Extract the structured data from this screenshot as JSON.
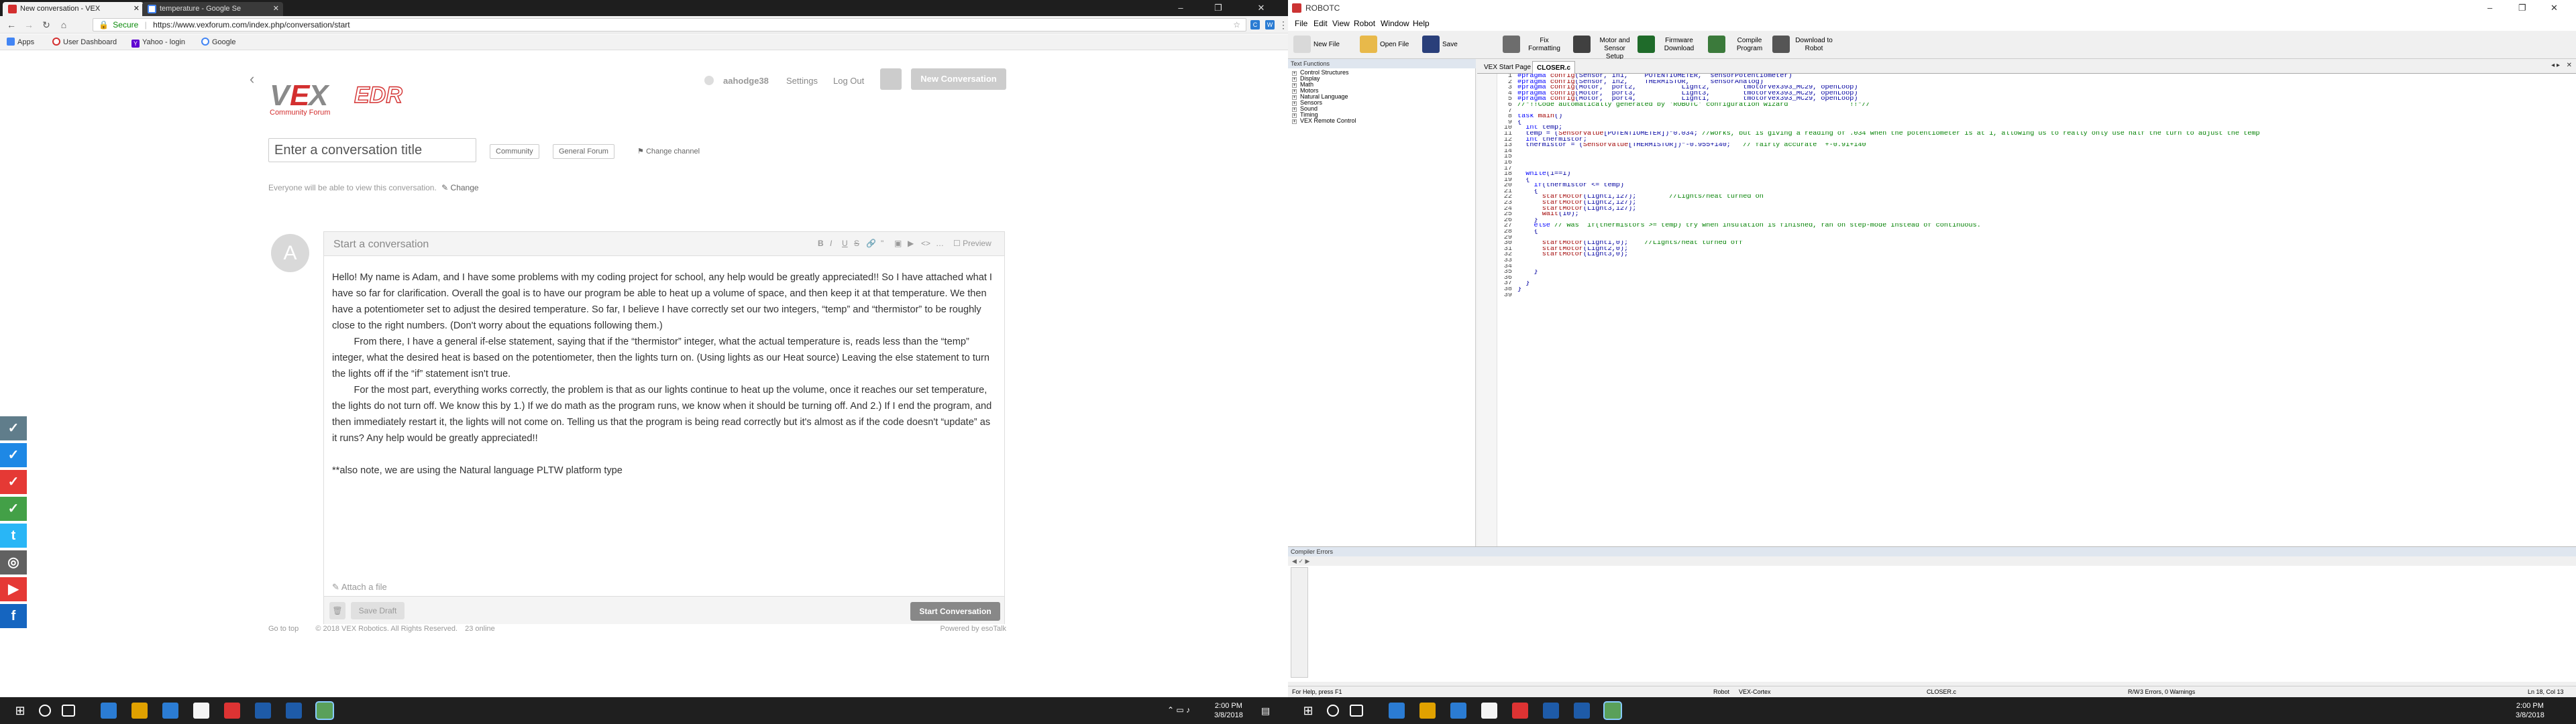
{
  "browser": {
    "tabs": [
      {
        "label": "New conversation - VEX",
        "active": true
      },
      {
        "label": "temperature - Google Se",
        "active": false
      }
    ],
    "window_controls": [
      "–",
      "❐",
      "✕"
    ],
    "secure_label": "Secure",
    "url": "https://www.vexforum.com/index.php/conversation/start",
    "bookmarks": [
      "Apps",
      "User Dashboard",
      "Yahoo - login",
      "Google"
    ]
  },
  "forum": {
    "logo_text": "VEX EDR",
    "logo_subtitle": "Community Forum",
    "header": {
      "username": "aahodge38",
      "settings": "Settings",
      "logout": "Log Out",
      "new_conversation": "New Conversation"
    },
    "title_placeholder": "Enter a conversation title",
    "channels": [
      "Community",
      "General Forum"
    ],
    "change_channel": "Change channel",
    "visibility_text": "Everyone will be able to view this conversation.",
    "visibility_change": "Change",
    "avatar_letter": "A",
    "editor_title": "Start a conversation",
    "format_tools": [
      "B",
      "I",
      "U",
      "S",
      "🔗",
      "\"",
      "▣",
      "▶",
      "<>",
      "…"
    ],
    "preview_label": "Preview",
    "body_paragraphs": [
      "Hello! My name is Adam, and I have some problems with my coding project for school, any help would be greatly appreciated!! So I have attached what I have so far for clarification. Overall the goal is to have our program be able to heat up a volume of space, and then keep it at that temperature. We then have a potentiometer set to adjust the desired temperature. So far, I believe I have correctly set our two integers, “temp” and “thermistor” to be roughly close to the right numbers. (Don't worry about the equations following them.)",
      "        From there, I have a general if-else statement, saying that if the “thermistor” integer, what the actual temperature is, reads less than the “temp” integer, what the desired heat is based on the potentiometer, then the lights turn on. (Using lights as our Heat source) Leaving the else statement to turn the lights off if the “if” statement isn't true.",
      "        For the most part, everything works correctly, the problem is that as our lights continue to heat up the volume, once it reaches our set temperature, the lights do not turn off. We know this by 1.) If we do math as the program runs, we know when it should be turning off. And 2.) If I end the program, and then immediately restart it, the lights will not come on. Telling us that the program is being read correctly but it's almost as if the code doesn't “update” as it runs? Any help would be greatly appreciated!!",
      "**also note, we are using the Natural language PLTW platform type"
    ],
    "attach_label": "Attach a file",
    "save_draft": "Save Draft",
    "start_conversation": "Start Conversation",
    "footer": {
      "goto_top": "Go to top",
      "copyright": "© 2018 VEX Robotics. All Rights Reserved.",
      "online": "23 online",
      "powered": "Powered by esoTalk"
    },
    "social_colors": [
      "#607d8b",
      "#1e88e5",
      "#e53935",
      "#43a047",
      "#29b6f6",
      "#616161",
      "#e53935",
      "#1565c0"
    ]
  },
  "robotc": {
    "title": "ROBOTC",
    "menus": [
      "File",
      "Edit",
      "View",
      "Robot",
      "Window",
      "Help"
    ],
    "toolbar": [
      {
        "label": "New File",
        "color": "#d9d9d9"
      },
      {
        "label": "Open File",
        "color": "#e8b94a"
      },
      {
        "label": "Save",
        "color": "#2a3f7a"
      },
      {
        "label": "Fix Formatting",
        "color": "#6d6d6d"
      },
      {
        "label": "Motor and Sensor Setup",
        "color": "#404040"
      },
      {
        "label": "Firmware Download",
        "color": "#1f6b2a"
      },
      {
        "label": "Compile Program",
        "color": "#3b7a3b"
      },
      {
        "label": "Download to Robot",
        "color": "#555555"
      }
    ],
    "functions_header": "Text Functions",
    "functions": [
      "Control Structures",
      "Display",
      "Math",
      "Motors",
      "Natural Language",
      "Sensors",
      "Sound",
      "Timing",
      "VEX Remote Control"
    ],
    "file_tabs": [
      "VEX Start Page",
      "CLOSER.c"
    ],
    "code_lines": [
      "#pragma config(Sensor, in1,    POTENTIOMETER,  sensorPotentiometer)",
      "#pragma config(Sensor, in2,    THERMISTOR,     sensorAnalog)",
      "#pragma config(Motor,  port2,           Light2,        tmotorVex393_MC29, openLoop)",
      "#pragma config(Motor,  port3,           Light3,        tmotorVex393_MC29, openLoop)",
      "#pragma config(Motor,  port4,           Light1,        tmotorVex393_MC29, openLoop)",
      "//*!!Code automatically generated by 'ROBOTC' configuration wizard               !!*//",
      "",
      "task main()",
      "{",
      "  int temp;",
      "  temp = (SensorValue[POTENTIOMETER])*0.034; //works, but is giving a reading of .034 when the potentiometer is at 1, allowing us to really only use half the turn to adjust the temp",
      "  int thermistor;",
      "  thermistor = (SensorValue[THERMISTOR])*-0.955+140;   // fairly accurate  +-0.91+140",
      "",
      "",
      "",
      "",
      "  while(1==1)",
      "  {",
      "    if(thermistor <= temp)",
      "    {",
      "      startMotor(Light1,127);        //Lights/heat turned on",
      "      startMotor(Light2,127);",
      "      startMotor(Light3,127);",
      "      wait(10);",
      "    }",
      "    else // was  if(thermistors >= temp) try when insulation is finished, ran on step-mode instead of continuous.",
      "    {",
      "",
      "      startMotor(Light1,0);    //Lights/heat turned off",
      "      startMotor(Light2,0);",
      "      startMotor(Light3,0);",
      "",
      "",
      "    }",
      "",
      "  }",
      "}",
      ""
    ],
    "error_panel_title": "Compiler Errors",
    "status": {
      "help": "For Help, press F1",
      "robot": "Robot",
      "platform": "VEX-Cortex",
      "file": "CLOSER.c",
      "mode": "R/W",
      "errors": "3 Errors, 0 Warnings",
      "position": "Ln 18, Col 13"
    }
  },
  "taskbar": {
    "left_time": "2:00 PM",
    "left_date": "3/8/2018",
    "right_time": "2:00 PM",
    "right_date": "3/8/2018",
    "app_colors": [
      "#2b7cd3",
      "#e0a100",
      "#2b7cd3",
      "#f5f5f5",
      "#d33",
      "#1e5ba8",
      "#1e5ba8",
      "#5aa05a"
    ]
  }
}
